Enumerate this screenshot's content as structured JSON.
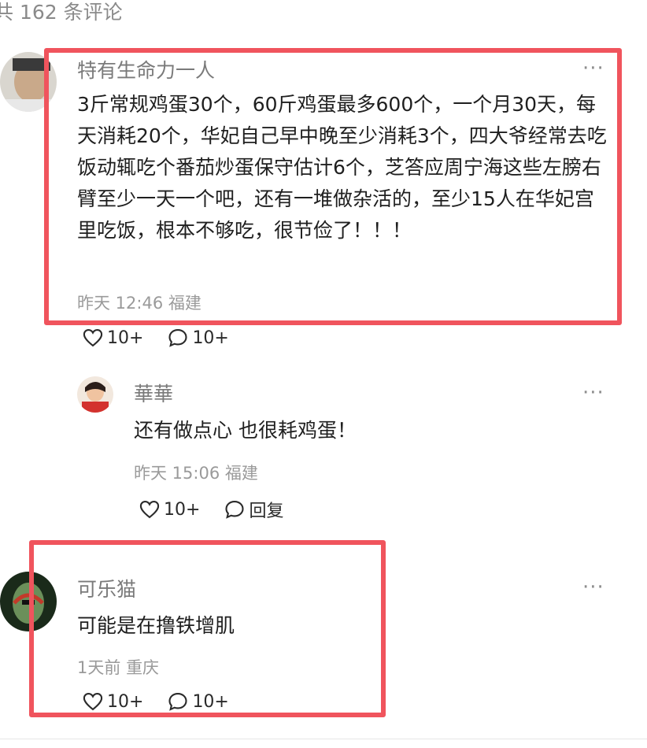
{
  "header": {
    "comment_count_text": "共 162 条评论"
  },
  "comments": [
    {
      "username": "特有生命力一人",
      "text": "3斤常规鸡蛋30个，60斤鸡蛋最多600个，一个月30天，每天消耗20个，华妃自己早中晚至少消耗3个，四大爷经常去吃饭动辄吃个番茄炒蛋保守估计6个，芝答应周宁海这些左膀右臂至少一天一个吧，还有一堆做杂活的，至少15人在华妃宫里吃饭，根本不够吃，很节俭了！！！",
      "time": "昨天 12:46",
      "location": "福建",
      "likes": "10+",
      "replies": "10+"
    },
    {
      "username": "華華",
      "text": "还有做点心 也很耗鸡蛋！",
      "time": "昨天 15:06",
      "location": "福建",
      "likes": "10+",
      "reply_label": "回复"
    },
    {
      "username": "可乐猫",
      "text": "可能是在撸铁增肌",
      "time": "1天前",
      "location": "重庆",
      "likes": "10+",
      "replies": "10+"
    }
  ],
  "icons": {
    "more": "more-icon",
    "like": "heart-icon",
    "comment": "comment-bubble-icon"
  },
  "colors": {
    "highlight_border": "#f0545d",
    "username": "#7a7a7a",
    "meta": "#9a9a9a",
    "text": "#1f1f1f"
  }
}
